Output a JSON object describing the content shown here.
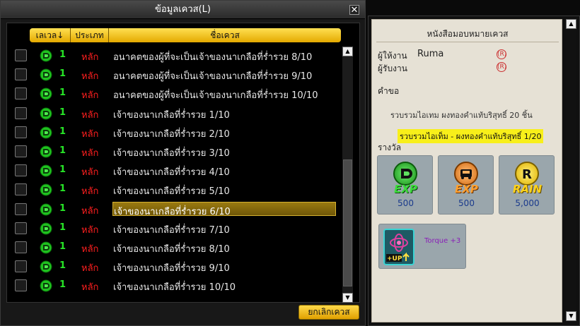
{
  "window": {
    "title": "ข้อมูลเควส(L)",
    "close_label": "✕"
  },
  "list": {
    "headers": {
      "level": "เลเวล↓",
      "type": "ประเภท",
      "name": "ชื่อเควส"
    },
    "rows": [
      {
        "level": "1",
        "type": "หลัก",
        "name": "อนาคตของผู้ที่จะเป็นเจ้าของนาเกลือที่ร่ำรวย 8/10"
      },
      {
        "level": "1",
        "type": "หลัก",
        "name": "อนาคตของผู้ที่จะเป็นเจ้าของนาเกลือที่ร่ำรวย 9/10"
      },
      {
        "level": "1",
        "type": "หลัก",
        "name": "อนาคตของผู้ที่จะเป็นเจ้าของนาเกลือที่ร่ำรวย 10/10"
      },
      {
        "level": "1",
        "type": "หลัก",
        "name": "เจ้าของนาเกลือที่ร่ำรวย 1/10"
      },
      {
        "level": "1",
        "type": "หลัก",
        "name": "เจ้าของนาเกลือที่ร่ำรวย 2/10"
      },
      {
        "level": "1",
        "type": "หลัก",
        "name": "เจ้าของนาเกลือที่ร่ำรวย 3/10"
      },
      {
        "level": "1",
        "type": "หลัก",
        "name": "เจ้าของนาเกลือที่ร่ำรวย 4/10"
      },
      {
        "level": "1",
        "type": "หลัก",
        "name": "เจ้าของนาเกลือที่ร่ำรวย 5/10"
      },
      {
        "level": "1",
        "type": "หลัก",
        "name": "เจ้าของนาเกลือที่ร่ำรวย 6/10",
        "selected": true
      },
      {
        "level": "1",
        "type": "หลัก",
        "name": "เจ้าของนาเกลือที่ร่ำรวย 7/10"
      },
      {
        "level": "1",
        "type": "หลัก",
        "name": "เจ้าของนาเกลือที่ร่ำรวย 8/10"
      },
      {
        "level": "1",
        "type": "หลัก",
        "name": "เจ้าของนาเกลือที่ร่ำรวย 9/10"
      },
      {
        "level": "1",
        "type": "หลัก",
        "name": "เจ้าของนาเกลือที่ร่ำรวย 10/10"
      }
    ],
    "cancel_button": "ยกเลิกเควส"
  },
  "detail": {
    "title": "หนังสือมอบหมายเควส",
    "giver_label": "ผู้ให้งาน",
    "giver_value": "Ruma",
    "receiver_label": "ผู้รับงาน",
    "mark": "(R)",
    "requirement_label": "คำขอ",
    "requirement_text": "รวบรวมไอเทม ผงทองคำแท้บริสุทธิ์ 20 ชิ้น",
    "progress_text": "รวบรวมไอเท็ม - ผงทองคำแท้บริสุทธิ์ 1/20",
    "reward_label": "รางวัล",
    "rewards": [
      {
        "word": "EXP",
        "value": "500",
        "icon": "green-exp-icon"
      },
      {
        "word": "EXP",
        "value": "500",
        "icon": "kart-exp-icon"
      },
      {
        "word": "RAIN",
        "value": "5,000",
        "icon": "rain-coin-icon"
      }
    ],
    "item": {
      "text": "Torque +3",
      "badge": "+UP"
    }
  },
  "colors": {
    "accent": "#ffd94a",
    "level_green": "#27e627",
    "type_red": "#ff1f1f"
  }
}
